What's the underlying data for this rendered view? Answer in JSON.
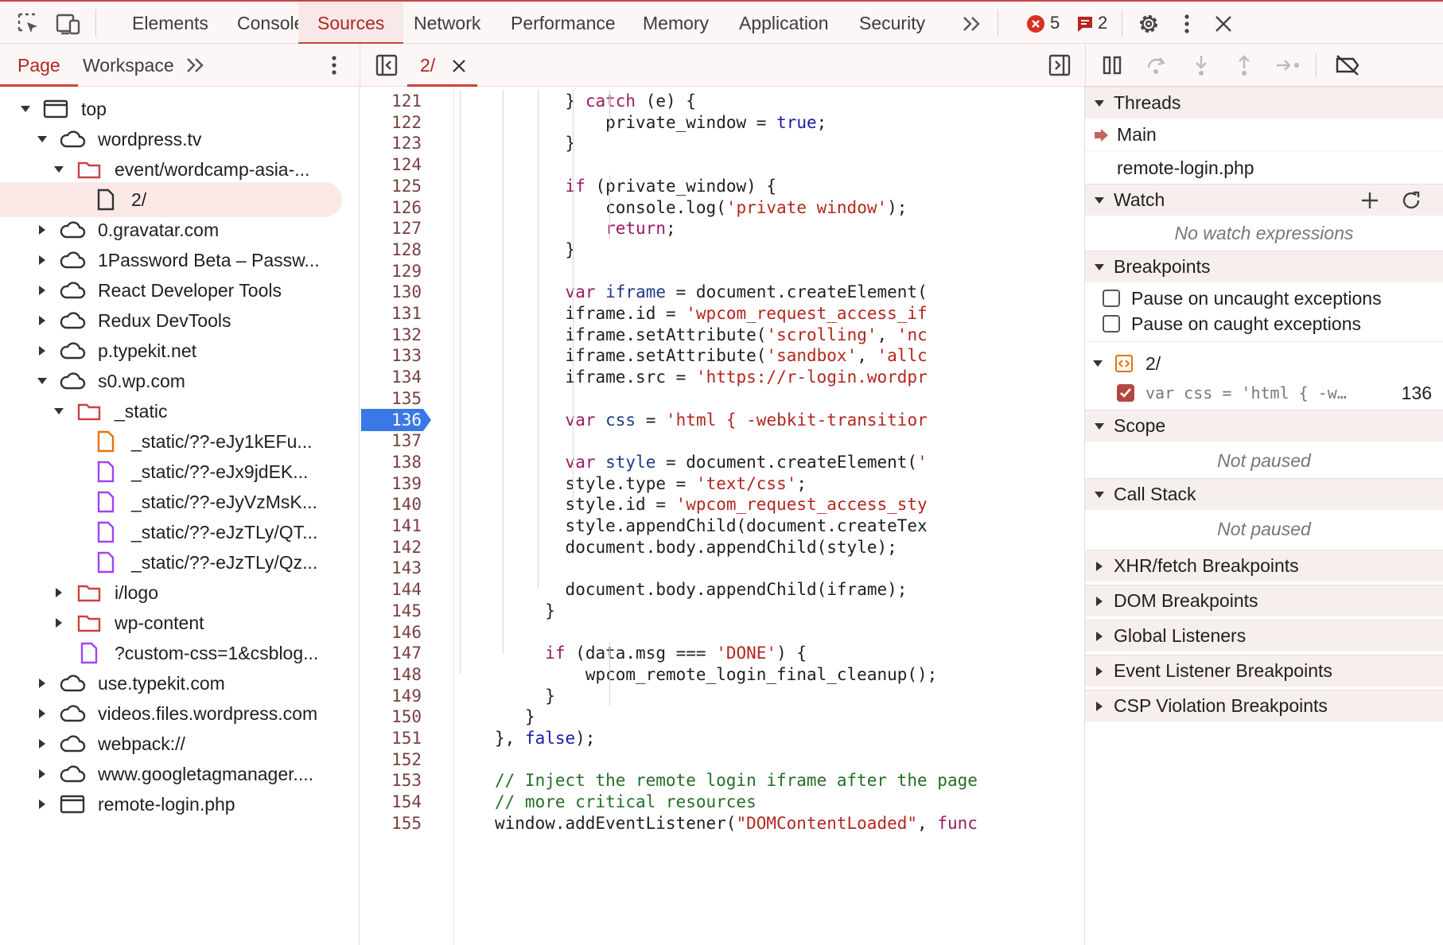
{
  "topbar": {
    "tabs": [
      {
        "label": "Elements"
      },
      {
        "label": "Console"
      },
      {
        "label": "Sources"
      },
      {
        "label": "Network"
      },
      {
        "label": "Performance"
      },
      {
        "label": "Memory"
      },
      {
        "label": "Application"
      },
      {
        "label": "Security"
      }
    ],
    "active_tab": "Sources",
    "more_tabs_icon": "chevron-double-right-icon",
    "error_count": "5",
    "message_count": "2"
  },
  "navigator": {
    "tabs": [
      {
        "label": "Page"
      },
      {
        "label": "Workspace"
      }
    ],
    "active_tab": "Page",
    "tree": [
      {
        "label": "top",
        "icon": "frame-icon",
        "expanded": true
      },
      {
        "label": "wordpress.tv",
        "icon": "cloud-icon",
        "expanded": true
      },
      {
        "label": "event/wordcamp-asia-...",
        "icon": "folder-icon",
        "expanded": true
      },
      {
        "label": "2/",
        "icon": "file-icon",
        "selected": true
      },
      {
        "label": "0.gravatar.com",
        "icon": "cloud-icon",
        "expanded": false
      },
      {
        "label": "1Password Beta – Passw...",
        "icon": "cloud-icon",
        "expanded": false
      },
      {
        "label": "React Developer Tools",
        "icon": "cloud-icon",
        "expanded": false
      },
      {
        "label": "Redux DevTools",
        "icon": "cloud-icon",
        "expanded": false
      },
      {
        "label": "p.typekit.net",
        "icon": "cloud-icon",
        "expanded": false
      },
      {
        "label": "s0.wp.com",
        "icon": "cloud-icon",
        "expanded": true
      },
      {
        "label": "_static",
        "icon": "folder-icon",
        "expanded": true
      },
      {
        "label": "_static/??-eJy1kEFu...",
        "icon": "js-file-icon"
      },
      {
        "label": "_static/??-eJx9jdEK...",
        "icon": "css-file-icon"
      },
      {
        "label": "_static/??-eJyVzMsK...",
        "icon": "css-file-icon"
      },
      {
        "label": "_static/??-eJzTLy/QT...",
        "icon": "css-file-icon"
      },
      {
        "label": "_static/??-eJzTLy/Qz...",
        "icon": "css-file-icon"
      },
      {
        "label": "i/logo",
        "icon": "folder-icon",
        "expanded": false
      },
      {
        "label": "wp-content",
        "icon": "folder-icon",
        "expanded": false
      },
      {
        "label": "?custom-css=1&csblog...",
        "icon": "css-file-icon"
      },
      {
        "label": "use.typekit.com",
        "icon": "cloud-icon",
        "expanded": false
      },
      {
        "label": "videos.files.wordpress.com",
        "icon": "cloud-icon",
        "expanded": false
      },
      {
        "label": "webpack://",
        "icon": "cloud-icon",
        "expanded": false
      },
      {
        "label": "www.googletagmanager....",
        "icon": "cloud-icon",
        "expanded": false
      },
      {
        "label": "remote-login.php",
        "icon": "frame-icon",
        "expanded": false
      }
    ]
  },
  "editor": {
    "open_file_tab": "2/",
    "breakpoint_line": 136,
    "lines": [
      {
        "n": "121",
        "tokens": [
          [
            "p",
            "} "
          ],
          [
            "kw",
            "catch"
          ],
          [
            "p",
            " (e) {"
          ]
        ]
      },
      {
        "n": "122",
        "tokens": [
          [
            "p",
            "    private_window = "
          ],
          [
            "lit",
            "true"
          ],
          [
            "p",
            ";"
          ]
        ]
      },
      {
        "n": "123",
        "tokens": [
          [
            "p",
            "}"
          ]
        ]
      },
      {
        "n": "124",
        "tokens": []
      },
      {
        "n": "125",
        "tokens": [
          [
            "kw",
            "if"
          ],
          [
            "p",
            " (private_window) {"
          ]
        ]
      },
      {
        "n": "126",
        "tokens": [
          [
            "p",
            "    console.log("
          ],
          [
            "str",
            "'private window'"
          ],
          [
            "p",
            ");"
          ]
        ]
      },
      {
        "n": "127",
        "tokens": [
          [
            "p",
            "    "
          ],
          [
            "kw",
            "return"
          ],
          [
            "p",
            ";"
          ]
        ]
      },
      {
        "n": "128",
        "tokens": [
          [
            "p",
            "}"
          ]
        ]
      },
      {
        "n": "129",
        "tokens": []
      },
      {
        "n": "130",
        "tokens": [
          [
            "kw",
            "var"
          ],
          [
            "p",
            " "
          ],
          [
            "ident",
            "iframe"
          ],
          [
            "p",
            " = document.createElement("
          ]
        ]
      },
      {
        "n": "131",
        "tokens": [
          [
            "p",
            "iframe.id = "
          ],
          [
            "str",
            "'wpcom_request_access_if"
          ]
        ]
      },
      {
        "n": "132",
        "tokens": [
          [
            "p",
            "iframe.setAttribute("
          ],
          [
            "str",
            "'scrolling'"
          ],
          [
            "p",
            ", "
          ],
          [
            "str",
            "'nc"
          ]
        ]
      },
      {
        "n": "133",
        "tokens": [
          [
            "p",
            "iframe.setAttribute("
          ],
          [
            "str",
            "'sandbox'"
          ],
          [
            "p",
            ", "
          ],
          [
            "str",
            "'allc"
          ]
        ]
      },
      {
        "n": "134",
        "tokens": [
          [
            "p",
            "iframe.src = "
          ],
          [
            "str",
            "'https://r-login.wordpr"
          ]
        ]
      },
      {
        "n": "135",
        "tokens": []
      },
      {
        "n": "136",
        "tokens": [
          [
            "kw",
            "var"
          ],
          [
            "p",
            " "
          ],
          [
            "ident",
            "css"
          ],
          [
            "p",
            " = "
          ],
          [
            "str",
            "'html { -webkit-transitior"
          ]
        ]
      },
      {
        "n": "137",
        "tokens": []
      },
      {
        "n": "138",
        "tokens": [
          [
            "kw",
            "var"
          ],
          [
            "p",
            " "
          ],
          [
            "ident",
            "style"
          ],
          [
            "p",
            " = document.createElement("
          ],
          [
            "str",
            "'"
          ]
        ]
      },
      {
        "n": "139",
        "tokens": [
          [
            "p",
            "style.type = "
          ],
          [
            "str",
            "'text/css'"
          ],
          [
            "p",
            ";"
          ]
        ]
      },
      {
        "n": "140",
        "tokens": [
          [
            "p",
            "style.id = "
          ],
          [
            "str",
            "'wpcom_request_access_sty"
          ]
        ]
      },
      {
        "n": "141",
        "tokens": [
          [
            "p",
            "style.appendChild(document.createTex"
          ]
        ]
      },
      {
        "n": "142",
        "tokens": [
          [
            "p",
            "document.body.appendChild(style);"
          ]
        ]
      },
      {
        "n": "143",
        "tokens": []
      },
      {
        "n": "144",
        "tokens": [
          [
            "p",
            "document.body.appendChild(iframe);"
          ]
        ]
      },
      {
        "n": "145",
        "tokens": [
          [
            "p",
            "}"
          ]
        ]
      },
      {
        "n": "146",
        "tokens": []
      },
      {
        "n": "147",
        "tokens": [
          [
            "kw",
            "if"
          ],
          [
            "p",
            " (data.msg === "
          ],
          [
            "str",
            "'DONE'"
          ],
          [
            "p",
            ") {"
          ]
        ]
      },
      {
        "n": "148",
        "tokens": [
          [
            "p",
            "    wpcom_remote_login_final_cleanup();"
          ]
        ]
      },
      {
        "n": "149",
        "tokens": [
          [
            "p",
            "}"
          ]
        ]
      },
      {
        "n": "150",
        "tokens": [
          [
            "p",
            "}"
          ]
        ]
      },
      {
        "n": "151",
        "tokens": [
          [
            "p",
            "}, "
          ],
          [
            "lit",
            "false"
          ],
          [
            "p",
            ");"
          ]
        ]
      },
      {
        "n": "152",
        "tokens": []
      },
      {
        "n": "153",
        "tokens": [
          [
            "cmt",
            "// Inject the remote login iframe after the page"
          ]
        ]
      },
      {
        "n": "154",
        "tokens": [
          [
            "cmt",
            "// more critical resources"
          ]
        ]
      },
      {
        "n": "155",
        "tokens": [
          [
            "p",
            "window.addEventListener("
          ],
          [
            "str",
            "\"DOMContentLoaded\""
          ],
          [
            "p",
            ", "
          ],
          [
            "kw",
            "func"
          ]
        ]
      }
    ]
  },
  "debugger": {
    "threads": {
      "title": "Threads",
      "items": [
        "Main",
        "remote-login.php"
      ]
    },
    "watch": {
      "title": "Watch",
      "empty": "No watch expressions"
    },
    "breakpoints": {
      "title": "Breakpoints",
      "pause_uncaught": "Pause on uncaught exceptions",
      "pause_caught": "Pause on caught exceptions",
      "file": "2/",
      "entry_code": "var css = 'html { -w…",
      "entry_line": "136"
    },
    "scope": {
      "title": "Scope",
      "status": "Not paused"
    },
    "call_stack": {
      "title": "Call Stack",
      "status": "Not paused"
    },
    "collapsed_sections": [
      "XHR/fetch Breakpoints",
      "DOM Breakpoints",
      "Global Listeners",
      "Event Listener Breakpoints",
      "CSP Violation Breakpoints"
    ]
  },
  "colors": {
    "accent": "#c9443e",
    "breakpoint": "#3b78e7",
    "tab_bar_bg": "#fdf6f6"
  }
}
